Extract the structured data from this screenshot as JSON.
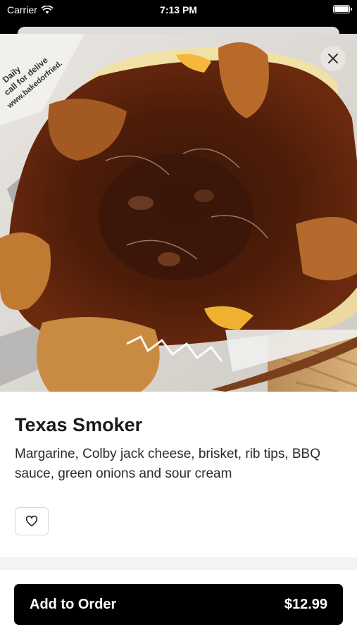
{
  "status_bar": {
    "carrier": "Carrier",
    "time": "7:13 PM",
    "wifi_icon": "wifi-icon",
    "battery_icon": "battery-icon"
  },
  "hero": {
    "image": "Texas Smoker baked potato photo",
    "wrapper_text": "Daily ... call for delivery ... www.bakedorfried...",
    "close_icon": "close-icon"
  },
  "item": {
    "title": "Texas Smoker",
    "description": "Margarine, Colby jack cheese, brisket, rib tips, BBQ sauce, green onions and sour cream",
    "favorite_icon": "heart-outline-icon"
  },
  "footer": {
    "button_label": "Add to Order",
    "price": "$12.99"
  },
  "colors": {
    "primary_button": "#000000",
    "background": "#ffffff",
    "divider": "#f3f3f3"
  }
}
